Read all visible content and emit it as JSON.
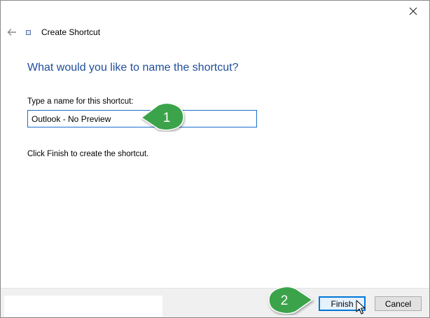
{
  "window": {
    "title": "Create Shortcut",
    "close_glyph": "✕"
  },
  "wizard": {
    "heading": "What would you like to name the shortcut?",
    "name_label": "Type a name for this shortcut:",
    "name_value": "Outlook - No Preview",
    "finish_note": "Click Finish to create the shortcut."
  },
  "footer": {
    "finish_label": "Finish",
    "cancel_label": "Cancel"
  },
  "callouts": [
    {
      "number": "1",
      "color": "#3aa34a"
    },
    {
      "number": "2",
      "color": "#3aa34a"
    }
  ],
  "colors": {
    "heading": "#1f4e9a",
    "accent": "#0078d7"
  },
  "icons": [
    "close-icon",
    "back-arrow-icon",
    "shortcut-wizard-icon",
    "pointer-cursor-icon"
  ]
}
